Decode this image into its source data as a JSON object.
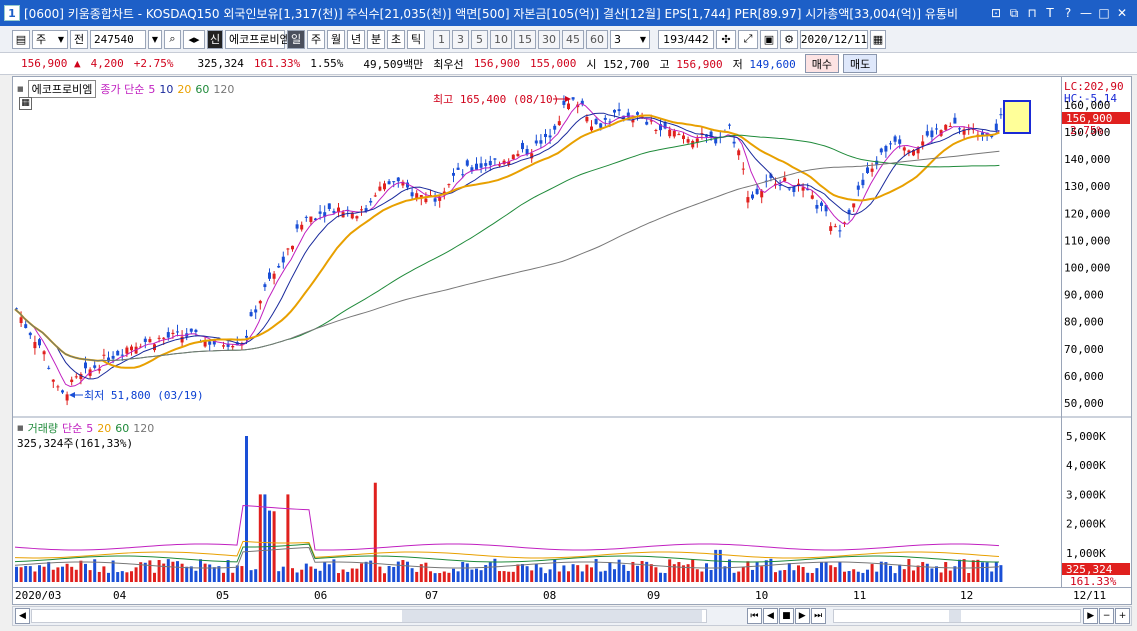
{
  "window": {
    "number": "1",
    "title": "[0600] 키움종합차트 - KOSDAQ150 외국인보유[1,317(천)] 주식수[21,035(천)] 액면[500] 자본금[105(억)] 결산[12월] EPS[1,744] PER[89.97] 시가총액[33,004(억)] 유통비",
    "controls": [
      "⊡",
      "⧉",
      "⊓",
      "T",
      "?",
      "—",
      "□",
      "✕"
    ]
  },
  "toolbar": {
    "period_select": "주",
    "prev_label": "전",
    "stock_code": "247540",
    "stock_name": "에코프로비엠",
    "badge": "신",
    "period_tabs": [
      "일",
      "주",
      "월",
      "년",
      "분",
      "초",
      "틱"
    ],
    "active_period": "일",
    "intervals": [
      "1",
      "3",
      "5",
      "10",
      "15",
      "30",
      "45",
      "60"
    ],
    "interval_select": "3",
    "count": "193",
    "count_total": "/442",
    "date": "2020/12/11"
  },
  "quote": {
    "price": "156,900",
    "arrow": "▲",
    "change": "4,200",
    "change_pct": "+2.75%",
    "volume": "325,324",
    "volume_ratio": "161.33%",
    "turnover": "1.55%",
    "amount": "49,509백만",
    "best_label": "최우선",
    "best_ask": "156,900",
    "best_bid": "155,000",
    "open_label": "시",
    "open": "152,700",
    "high_label": "고",
    "high": "156,900",
    "low_label": "저",
    "low": "149,600",
    "buy_button": "매수",
    "sell_button": "매도"
  },
  "price_panel": {
    "stock_label": "에코프로비엠",
    "ma_title": "종가 단순",
    "ma_periods": [
      "5",
      "10",
      "20",
      "60",
      "120"
    ],
    "ma_colors": [
      "#c020c0",
      "#1a2a9c",
      "#e8a000",
      "#1f8a3a",
      "#777777"
    ],
    "high_note": "최고 165,400 (08/10)",
    "low_note": "최저 51,800 (03/19)",
    "axis_labels": [
      "160,000",
      "150,000",
      "140,000",
      "130,000",
      "120,000",
      "110,000",
      "100,000",
      "90,000",
      "80,000",
      "70,000",
      "60,000",
      "50,000"
    ],
    "lc": "LC:202,90",
    "hc": "HC:-5,14",
    "last_price": "156,900",
    "last_pct": "2.75%"
  },
  "volume_panel": {
    "title": "거래량",
    "ma_title": "단순",
    "ma_periods": [
      "5",
      "20",
      "60",
      "120"
    ],
    "current": "325,324주(161,33%)",
    "axis_labels": [
      "5,000K",
      "4,000K",
      "3,000K",
      "2,000K",
      "1,000K"
    ],
    "last_volume": "325,324",
    "last_pct": "161.33%"
  },
  "xaxis": {
    "labels": [
      "2020/03",
      "04",
      "05",
      "06",
      "07",
      "08",
      "09",
      "10",
      "11",
      "12"
    ],
    "right_label": "12/11"
  },
  "colors": {
    "up": "#e0201e",
    "down": "#1a4fd6",
    "title_bg": "#1d5fc7"
  }
}
